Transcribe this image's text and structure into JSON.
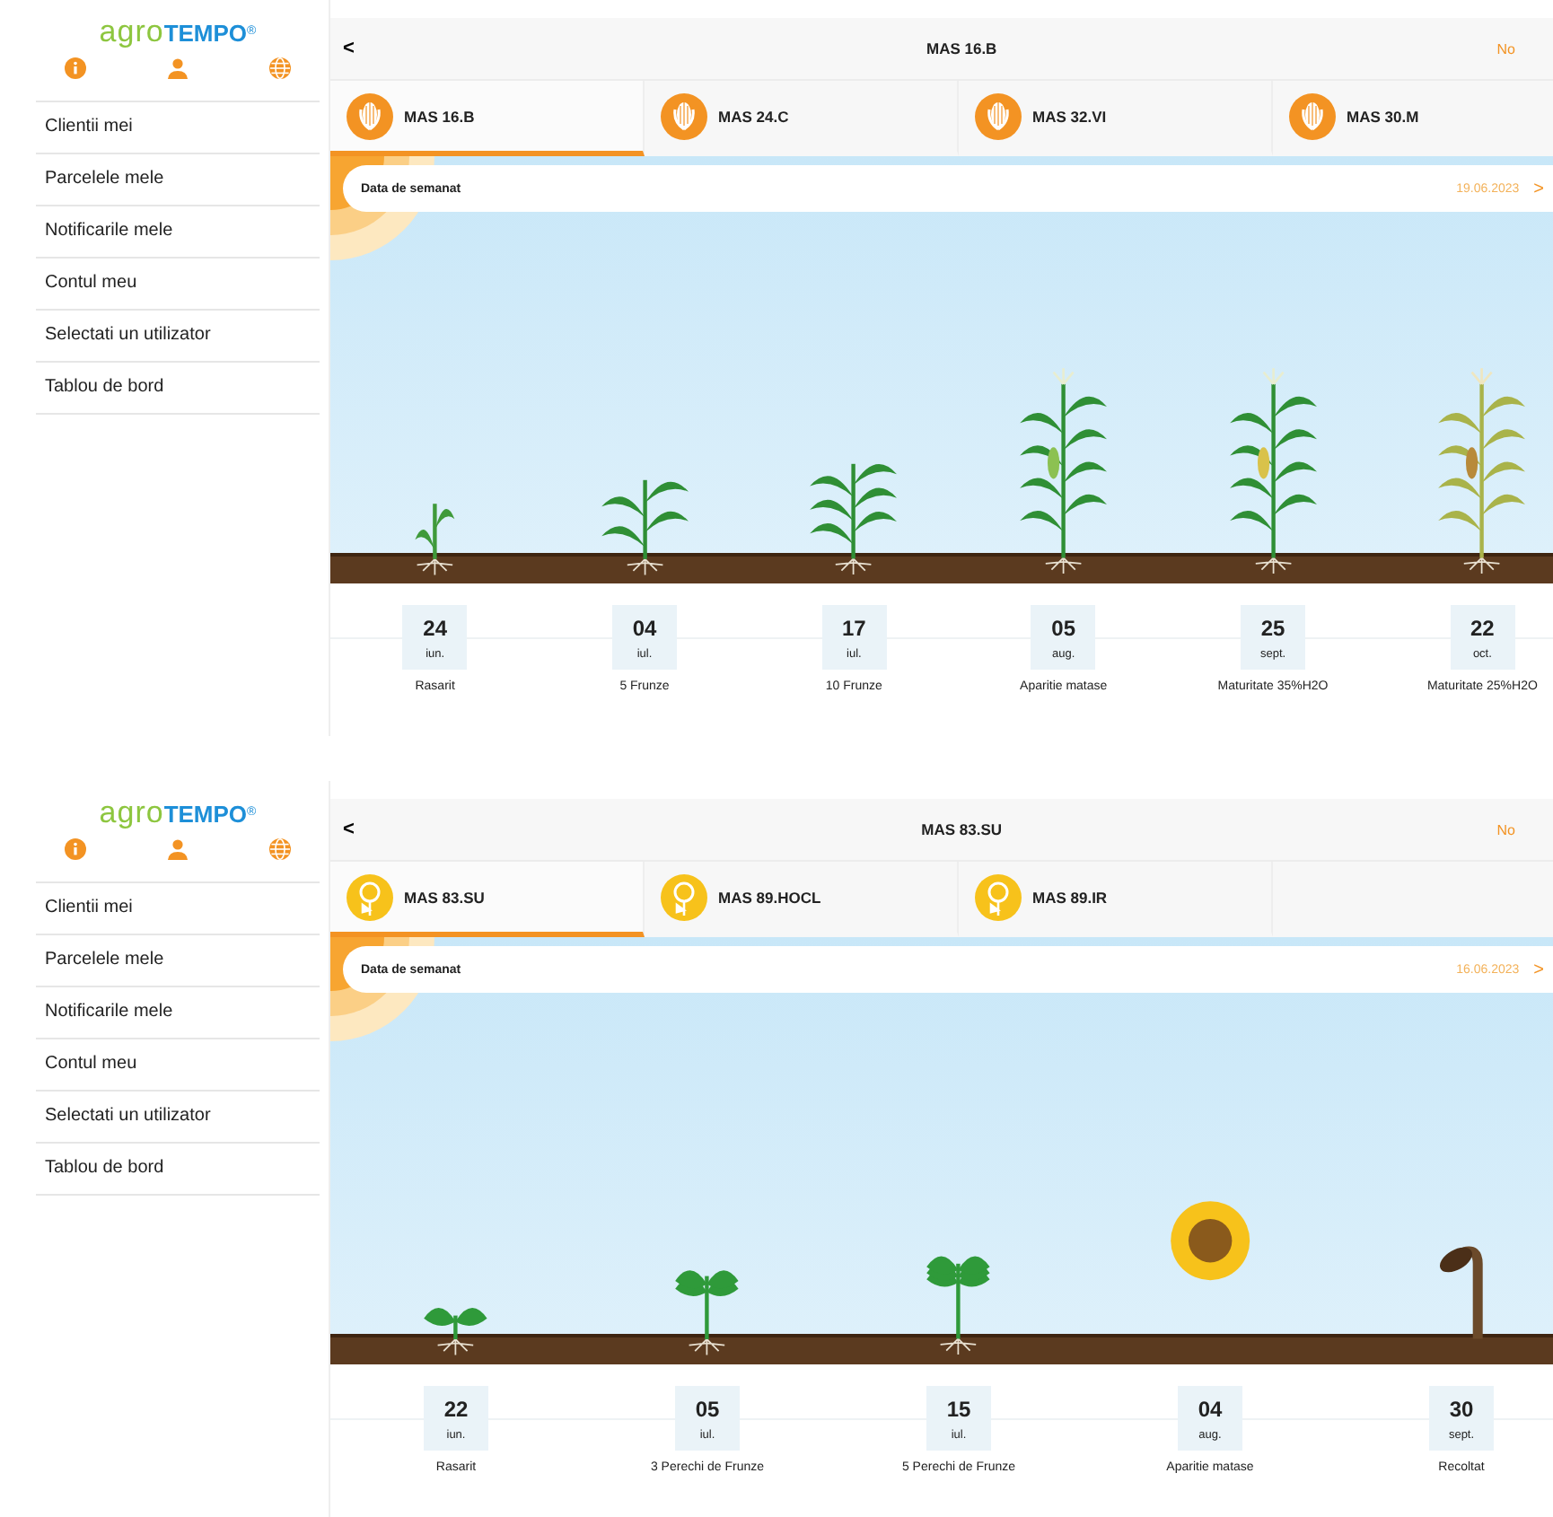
{
  "panels": [
    {
      "logo": {
        "main": "agro",
        "accent": "TEMPO",
        "mark": "®"
      },
      "sidebar": {
        "items": [
          {
            "label": "Clientii mei"
          },
          {
            "label": "Parcelele mele"
          },
          {
            "label": "Notificarile mele"
          },
          {
            "label": "Contul meu"
          },
          {
            "label": "Selectati un utilizator"
          },
          {
            "label": "Tablou de bord"
          }
        ]
      },
      "header": {
        "back": "<",
        "title": "MAS 16.B",
        "action": "No"
      },
      "tabs": [
        {
          "label": "MAS 16.B",
          "kind": "corn",
          "selected": true
        },
        {
          "label": "MAS 24.C",
          "kind": "corn",
          "selected": false
        },
        {
          "label": "MAS 32.VI",
          "kind": "corn",
          "selected": false
        },
        {
          "label": "MAS 30.M",
          "kind": "corn",
          "selected": false
        }
      ],
      "sowing": {
        "label": "Data de semanat",
        "date": "19.06.2023",
        "chevron": ">"
      },
      "stages": [
        {
          "day": "24",
          "month": "iun.",
          "label": "Rasarit",
          "kind": "sprout"
        },
        {
          "day": "04",
          "month": "iul.",
          "label": "5 Frunze",
          "kind": "young"
        },
        {
          "day": "17",
          "month": "iul.",
          "label": "10 Frunze",
          "kind": "leafy"
        },
        {
          "day": "05",
          "month": "aug.",
          "label": "Aparitie matase",
          "kind": "silk"
        },
        {
          "day": "25",
          "month": "sept.",
          "label": "Maturitate 35%H2O",
          "kind": "mature"
        },
        {
          "day": "22",
          "month": "oct.",
          "label": "Maturitate 25%H2O",
          "kind": "dry"
        }
      ]
    },
    {
      "logo": {
        "main": "agro",
        "accent": "TEMPO",
        "mark": "®"
      },
      "sidebar": {
        "items": [
          {
            "label": "Clientii mei"
          },
          {
            "label": "Parcelele mele"
          },
          {
            "label": "Notificarile mele"
          },
          {
            "label": "Contul meu"
          },
          {
            "label": "Selectati un utilizator"
          },
          {
            "label": "Tablou de bord"
          }
        ]
      },
      "header": {
        "back": "<",
        "title": "MAS 83.SU",
        "action": "No"
      },
      "tabs": [
        {
          "label": "MAS 83.SU",
          "kind": "sunflower",
          "selected": true
        },
        {
          "label": "MAS 89.HOCL",
          "kind": "sunflower",
          "selected": false
        },
        {
          "label": "MAS 89.IR",
          "kind": "sunflower",
          "selected": false
        }
      ],
      "sowing": {
        "label": "Data de semanat",
        "date": "16.06.2023",
        "chevron": ">"
      },
      "stages": [
        {
          "day": "22",
          "month": "iun.",
          "label": "Rasarit",
          "kind": "seedling"
        },
        {
          "day": "05",
          "month": "iul.",
          "label": "3 Perechi de Frunze",
          "kind": "pairs"
        },
        {
          "day": "15",
          "month": "iul.",
          "label": "5 Perechi de Frunze",
          "kind": "bush"
        },
        {
          "day": "04",
          "month": "aug.",
          "label": "Aparitie matase",
          "kind": "bloom"
        },
        {
          "day": "30",
          "month": "sept.",
          "label": "Recoltat",
          "kind": "harvest"
        }
      ]
    }
  ]
}
